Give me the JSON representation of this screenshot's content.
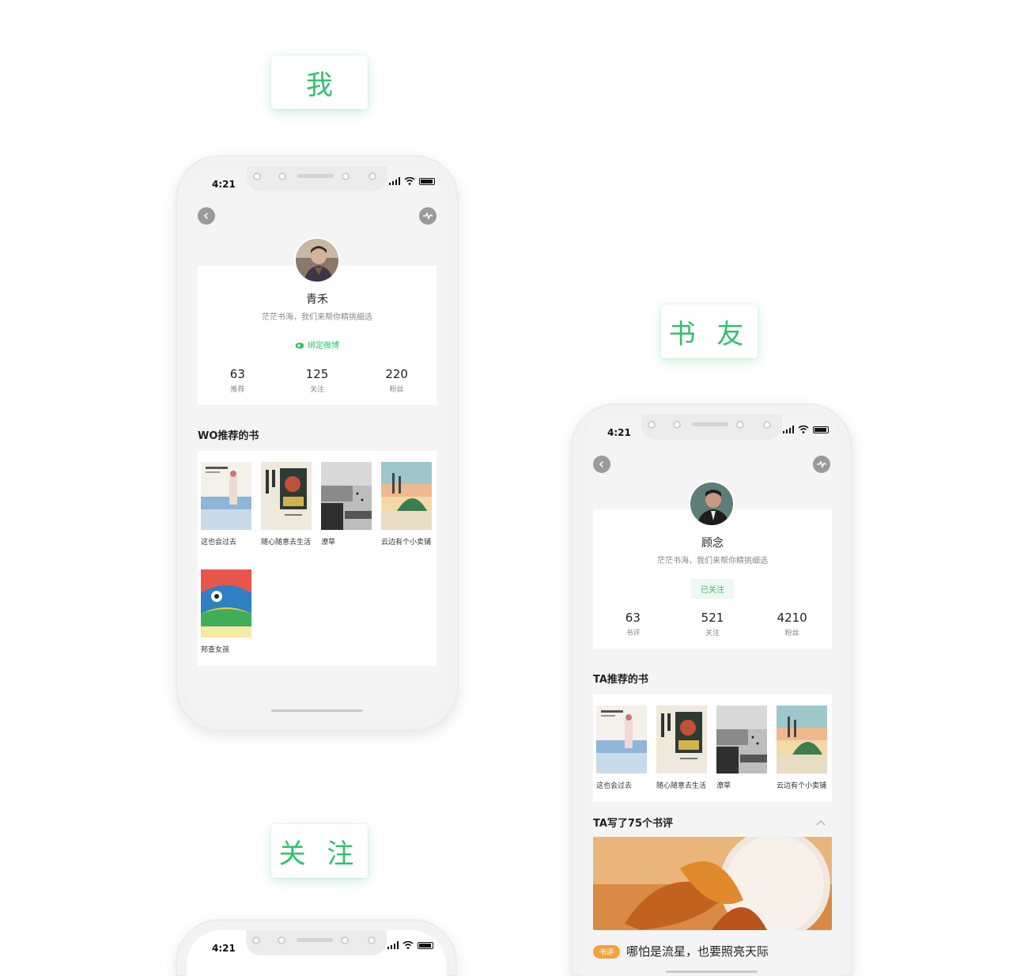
{
  "labels": {
    "me": "我",
    "bookfriend": "书 友",
    "follow": "关 注"
  },
  "colors": {
    "accent": "#2fc26d",
    "tag": "#f3a33e"
  },
  "status_bar": {
    "time": "4:21"
  },
  "me_screen": {
    "user": {
      "name": "青禾",
      "bio": "茫茫书海，我们来帮你精挑细选",
      "weibo_link": "绑定微博"
    },
    "stats": [
      {
        "num": "63",
        "label": "推荐"
      },
      {
        "num": "125",
        "label": "关注"
      },
      {
        "num": "220",
        "label": "粉丝"
      }
    ],
    "section_title": "WO推荐的书",
    "books": [
      "这也会过去",
      "随心随意去生活",
      "潦草",
      "云边有个小卖铺",
      "邦查女孩"
    ]
  },
  "friend_screen": {
    "user": {
      "name": "顾念",
      "bio": "茫茫书海，我们来帮你精挑细选",
      "follow_state": "已关注"
    },
    "stats": [
      {
        "num": "63",
        "label": "书评"
      },
      {
        "num": "521",
        "label": "关注"
      },
      {
        "num": "4210",
        "label": "粉丝"
      }
    ],
    "section_title": "TA推荐的书",
    "books": [
      "这也会过去",
      "随心随意去生活",
      "潦草",
      "云边有个小卖铺"
    ],
    "reviews_title": "TA写了75个书评",
    "review": {
      "tag": "书评",
      "title": "哪怕是流星，也要照亮天际"
    }
  },
  "follow_screen": {
    "time": "4:21"
  },
  "icons": {
    "back": "chevron-left-icon",
    "activity": "pulse-icon",
    "weibo": "weibo-icon",
    "signal": "signal-icon",
    "wifi": "wifi-icon",
    "battery": "battery-icon",
    "collapse": "chevron-up-icon"
  }
}
